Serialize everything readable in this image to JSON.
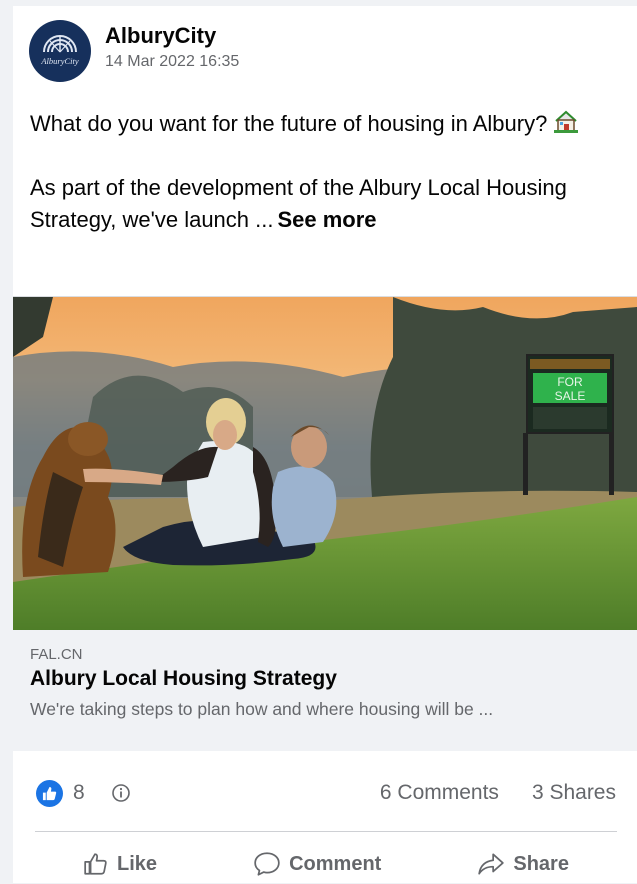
{
  "post": {
    "page_name": "AlburyCity",
    "avatar_text": "AlburyCity",
    "timestamp": "14 Mar 2022 16:35",
    "text_line1": "What do you want for the future of housing in Albury?",
    "text_line2": "As part of the development of the Albury Local Housing Strategy, we've launch ...",
    "see_more": "See more",
    "emoji_icon": "house-with-garden-icon"
  },
  "photo": {
    "sign_line1": "FOR",
    "sign_line2": "SALE"
  },
  "link_preview": {
    "domain": "FAL.CN",
    "title": "Albury Local Housing Strategy",
    "description": "We're taking steps to plan how and where housing will be ..."
  },
  "stats": {
    "like_count": "8",
    "comments": "6 Comments",
    "shares": "3 Shares"
  },
  "actions": {
    "like": "Like",
    "comment": "Comment",
    "share": "Share"
  },
  "colors": {
    "accent": "#1b74e4",
    "secondary_text": "#65676b",
    "preview_bg": "#f0f2f5"
  }
}
